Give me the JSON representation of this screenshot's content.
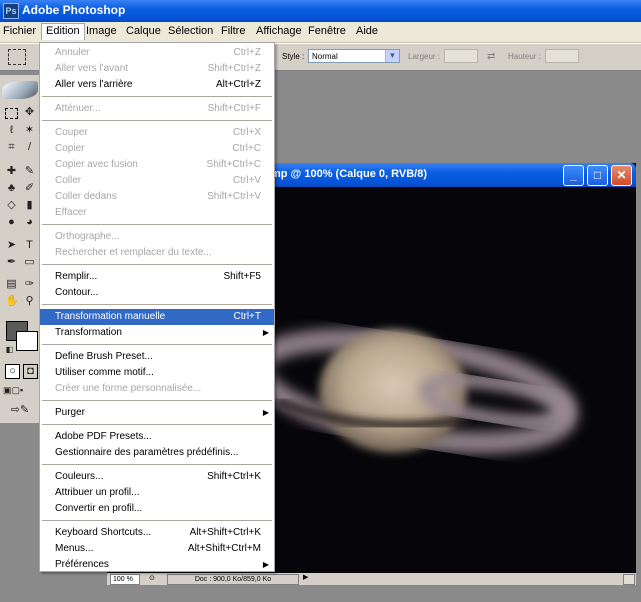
{
  "app": {
    "title": "Adobe Photoshop",
    "icon": "photoshop-logo-icon"
  },
  "menubar": {
    "items": [
      "Fichier",
      "Edition",
      "Image",
      "Calque",
      "Sélection",
      "Filtre",
      "Affichage",
      "Fenêtre",
      "Aide"
    ],
    "active": "Edition"
  },
  "options": {
    "style_label": "Style :",
    "style_value": "Normal",
    "width_label": "Largeur :",
    "height_label": "Hauteur :"
  },
  "document": {
    "title": "mp @ 100% (Calque 0, RVB/8)",
    "zoom": "100 %",
    "doc_size": "Doc : 900,0 Ko/859,0 Ko"
  },
  "edit_menu": {
    "items": [
      {
        "label": "Annuler",
        "shortcut": "Ctrl+Z",
        "disabled": true
      },
      {
        "label": "Aller vers l'avant",
        "shortcut": "Shift+Ctrl+Z",
        "disabled": true
      },
      {
        "label": "Aller vers l'arrière",
        "shortcut": "Alt+Ctrl+Z",
        "disabled": false
      },
      {
        "sep": true
      },
      {
        "label": "Atténuer...",
        "shortcut": "Shift+Ctrl+F",
        "disabled": true
      },
      {
        "sep": true
      },
      {
        "label": "Couper",
        "shortcut": "Ctrl+X",
        "disabled": true
      },
      {
        "label": "Copier",
        "shortcut": "Ctrl+C",
        "disabled": true
      },
      {
        "label": "Copier avec fusion",
        "shortcut": "Shift+Ctrl+C",
        "disabled": true
      },
      {
        "label": "Coller",
        "shortcut": "Ctrl+V",
        "disabled": true
      },
      {
        "label": "Coller dedans",
        "shortcut": "Shift+Ctrl+V",
        "disabled": true
      },
      {
        "label": "Effacer",
        "shortcut": "",
        "disabled": true
      },
      {
        "sep": true
      },
      {
        "label": "Orthographe...",
        "shortcut": "",
        "disabled": true
      },
      {
        "label": "Rechercher et remplacer du texte...",
        "shortcut": "",
        "disabled": true
      },
      {
        "sep": true
      },
      {
        "label": "Remplir...",
        "shortcut": "Shift+F5",
        "disabled": false
      },
      {
        "label": "Contour...",
        "shortcut": "",
        "disabled": false
      },
      {
        "sep": true
      },
      {
        "label": "Transformation manuelle",
        "shortcut": "Ctrl+T",
        "disabled": false,
        "selected": true
      },
      {
        "label": "Transformation",
        "shortcut": "",
        "disabled": false,
        "submenu": true
      },
      {
        "sep": true
      },
      {
        "label": "Define Brush Preset...",
        "shortcut": "",
        "disabled": false
      },
      {
        "label": "Utiliser comme motif...",
        "shortcut": "",
        "disabled": false
      },
      {
        "label": "Créer une forme personnalisée...",
        "shortcut": "",
        "disabled": true
      },
      {
        "sep": true
      },
      {
        "label": "Purger",
        "shortcut": "",
        "disabled": false,
        "submenu": true
      },
      {
        "sep": true
      },
      {
        "label": "Adobe PDF Presets...",
        "shortcut": "",
        "disabled": false
      },
      {
        "label": "Gestionnaire des paramètres prédéfinis...",
        "shortcut": "",
        "disabled": false
      },
      {
        "sep": true
      },
      {
        "label": "Couleurs...",
        "shortcut": "Shift+Ctrl+K",
        "disabled": false
      },
      {
        "label": "Attribuer un profil...",
        "shortcut": "",
        "disabled": false
      },
      {
        "label": "Convertir en profil...",
        "shortcut": "",
        "disabled": false
      },
      {
        "sep": true
      },
      {
        "label": "Keyboard Shortcuts...",
        "shortcut": "Alt+Shift+Ctrl+K",
        "disabled": false
      },
      {
        "label": "Menus...",
        "shortcut": "Alt+Shift+Ctrl+M",
        "disabled": false
      },
      {
        "label": "Préférences",
        "shortcut": "",
        "disabled": false,
        "submenu": true
      }
    ]
  },
  "colors": {
    "titlebar": "#0553d6",
    "menu_highlight": "#316ac5",
    "foreground_swatch": "#5a5a5a",
    "background_swatch": "#ffffff"
  }
}
